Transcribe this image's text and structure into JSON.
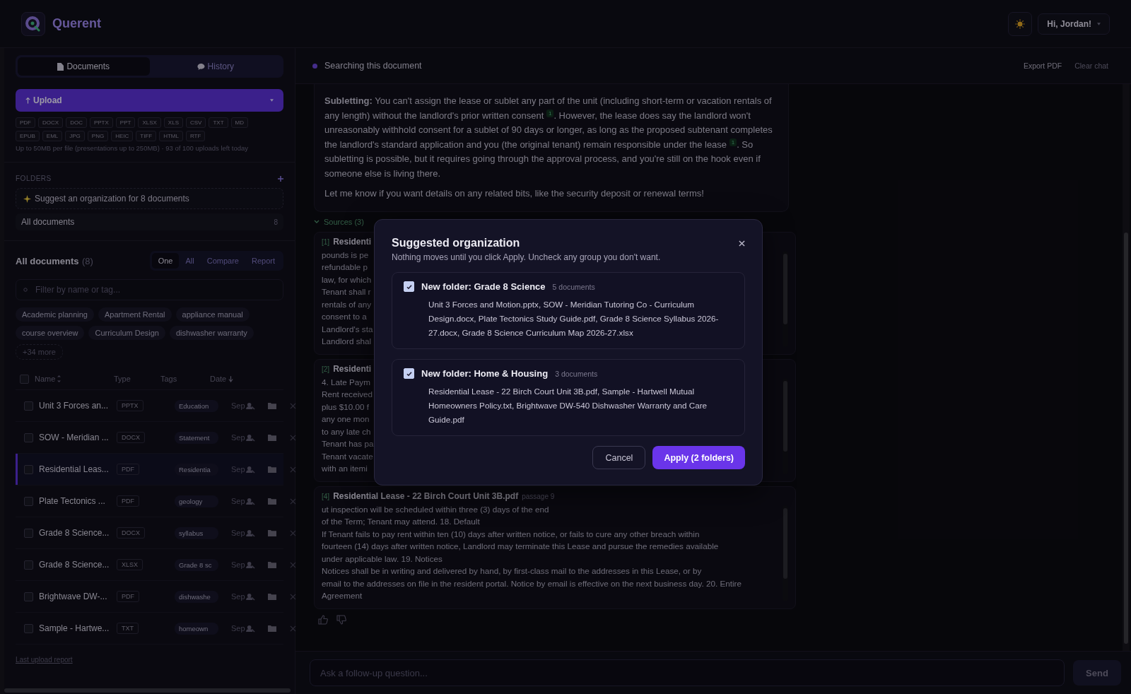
{
  "app": {
    "name": "Querent"
  },
  "header": {
    "greeting": "Hi, Jordan!"
  },
  "sidebar": {
    "tabs": [
      {
        "label": "Documents",
        "selected": true
      },
      {
        "label": "History",
        "selected": false
      }
    ],
    "upload": {
      "label": "Upload"
    },
    "formats": [
      "PDF",
      "DOCX",
      "DOC",
      "PPTX",
      "PPT",
      "XLSX",
      "XLS",
      "CSV",
      "TXT",
      "MD",
      "EPUB",
      "EML",
      "JPG",
      "PNG",
      "HEIC",
      "TIFF",
      "HTML",
      "RTF"
    ],
    "limits": "Up to 50MB per file (presentations up to 250MB) · 93 of 100 uploads left today",
    "folders": {
      "heading": "FOLDERS",
      "suggest": "Suggest an organization for 8 documents",
      "items": [
        {
          "name": "All documents",
          "count": "8"
        }
      ]
    },
    "documents": {
      "heading": "All documents",
      "count": "(8)",
      "modes": [
        {
          "label": "One",
          "selected": true
        },
        {
          "label": "All",
          "selected": false
        },
        {
          "label": "Compare",
          "selected": false
        },
        {
          "label": "Report",
          "selected": false
        }
      ],
      "filter": {
        "placeholder": "Filter by name or tag..."
      },
      "tags": [
        "Academic planning",
        "Apartment Rental",
        "appliance manual",
        "course overview",
        "Curriculum Design",
        "dishwasher warranty"
      ],
      "more_tags": "+34 more",
      "all_checked": false,
      "columns": [
        {
          "label": "Name",
          "sortable": true
        },
        {
          "label": "Type"
        },
        {
          "label": "Tags"
        },
        {
          "label": "Date",
          "sorted": true
        }
      ],
      "rows": [
        {
          "name": "Unit 3 Forces an...",
          "type": "PPTX",
          "tag": "Education",
          "date": "Sep",
          "selected": false,
          "checked": false
        },
        {
          "name": "SOW - Meridian ...",
          "type": "DOCX",
          "tag": "Statement",
          "date": "Sep",
          "selected": false,
          "checked": false
        },
        {
          "name": "Residential Leas...",
          "type": "PDF",
          "tag": "Residentia",
          "date": "Sep",
          "selected": true,
          "checked": false
        },
        {
          "name": "Plate Tectonics ...",
          "type": "PDF",
          "tag": "geology",
          "date": "Sep",
          "selected": false,
          "checked": false
        },
        {
          "name": "Grade 8 Science...",
          "type": "DOCX",
          "tag": "syllabus",
          "date": "Sep",
          "selected": false,
          "checked": false
        },
        {
          "name": "Grade 8 Science...",
          "type": "XLSX",
          "tag": "Grade 8 sc",
          "date": "Sep",
          "selected": false,
          "checked": false
        },
        {
          "name": "Brightwave DW-...",
          "type": "PDF",
          "tag": "dishwashe",
          "date": "Sep",
          "selected": false,
          "checked": false
        },
        {
          "name": "Sample - Hartwe...",
          "type": "TXT",
          "tag": "homeown",
          "date": "Sep",
          "selected": false,
          "checked": false
        }
      ]
    },
    "footer_link": "Last upload report"
  },
  "chat": {
    "status": "Searching this document",
    "actions": [
      {
        "label": "Export PDF",
        "disabled": false
      },
      {
        "label": "Clear chat",
        "disabled": true
      }
    ],
    "answer": [
      [
        {
          "text": "**Subletting:** You can't assign the lease or sublet any part of the unit (including short-term or vacation rentals of any length) without the landlord's prior written consent "
        },
        {
          "cite": "1"
        },
        {
          "text": ". However, the lease does say the landlord won't unreasonably withhold consent for a sublet of 90 days or longer, as long as the proposed subtenant completes the landlord's standard application and you (the original tenant) remain responsible under the lease "
        },
        {
          "cite": "1"
        },
        {
          "text": ". So subletting is possible, but it requires going through the approval process, and you're still on the hook even if someone else is living there."
        }
      ],
      [
        {
          "text": "Let me know if you want details on any related bits, like the security deposit or renewal terms!"
        }
      ]
    ],
    "sources_label": "Sources (3)",
    "sources_expanded": true,
    "sources": [
      {
        "index": "[1]",
        "title": "Residenti",
        "lines": [
          "pounds is pe",
          "refundable p",
          "law, for which",
          "Tenant shall r",
          "rentals of any",
          "consent to a",
          "Landlord's sta",
          "Landlord shal"
        ]
      },
      {
        "index": "[2]",
        "title": "Residenti",
        "lines": [
          "4. Late Paym",
          "Rent received",
          "plus $10.00 f",
          "any one mon",
          "to any late ch",
          "Tenant has pa",
          "Tenant vacate",
          "with an itemi"
        ]
      },
      {
        "index": "[4]",
        "title": "Residential Lease - 22 Birch Court Unit 3B.pdf",
        "passage": "passage 9",
        "lines": [
          "ut inspection will be scheduled within three (3) days of the end",
          "of the Term; Tenant may attend. 18. Default",
          "If Tenant fails to pay rent within ten (10) days after written notice, or fails to cure any other breach within",
          "fourteen (14) days after written notice, Landlord may terminate this Lease and pursue the remedies available",
          "under applicable law. 19. Notices",
          "Notices shall be in writing and delivered by hand, by first-class mail to the addresses in this Lease, or by",
          "email to the addresses on file in the resident portal. Notice by email is effective on the next business day. 20. Entire",
          "Agreement"
        ]
      }
    ],
    "input": {
      "placeholder": "Ask a follow-up question..."
    },
    "send": {
      "label": "Send",
      "disabled": true
    }
  },
  "modal": {
    "title": "Suggested organization",
    "subtitle": "Nothing moves until you click Apply. Uncheck any group you don't want.",
    "groups": [
      {
        "title": "New folder: Grade 8 Science",
        "count": "5 documents",
        "checked": true,
        "files": "Unit 3 Forces and Motion.pptx, SOW - Meridian Tutoring Co - Curriculum Design.docx, Plate Tectonics Study Guide.pdf, Grade 8 Science Syllabus 2026-27.docx, Grade 8 Science Curriculum Map 2026-27.xlsx"
      },
      {
        "title": "New folder: Home & Housing",
        "count": "3 documents",
        "checked": true,
        "files": "Residential Lease - 22 Birch Court Unit 3B.pdf, Sample - Hartwell Mutual Homeowners Policy.txt, Brightwave DW-540 Dishwasher Warranty and Care Guide.pdf"
      }
    ],
    "cancel": "Cancel",
    "apply": "Apply (2 folders)"
  }
}
